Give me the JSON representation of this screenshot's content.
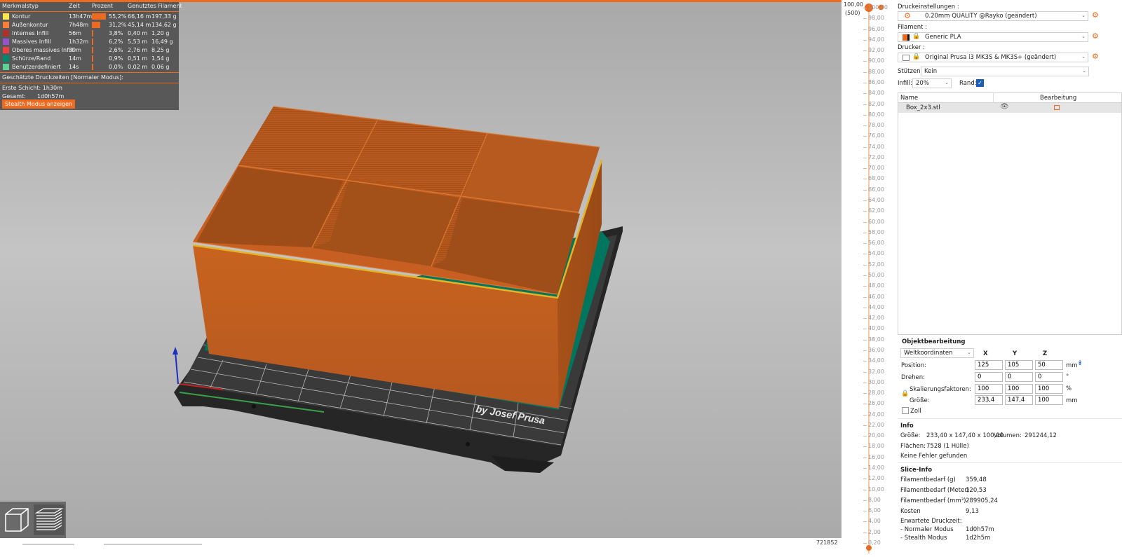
{
  "legend": {
    "headers": {
      "type": "Merkmalstyp",
      "time": "Zeit",
      "percent": "Prozent",
      "filament": "Genutztes Filament"
    },
    "rows": [
      {
        "name": "Kontur",
        "color": "#ffe64d",
        "time": "13h47m",
        "percent": "55,2%",
        "fraction": 0.552,
        "meters": "66,16 m",
        "grams": "197,33 g"
      },
      {
        "name": "Außenkontur",
        "color": "#ff7d38",
        "time": "7h48m",
        "percent": "31,2%",
        "fraction": 0.312,
        "meters": "45,14 m",
        "grams": "134,62 g"
      },
      {
        "name": "Internes Infill",
        "color": "#b03029",
        "time": "56m",
        "percent": "3,8%",
        "fraction": 0.038,
        "meters": "0,40 m",
        "grams": "1,20 g"
      },
      {
        "name": "Massives Infill",
        "color": "#9654cc",
        "time": "1h32m",
        "percent": "6,2%",
        "fraction": 0.062,
        "meters": "5,53 m",
        "grams": "16,49 g"
      },
      {
        "name": "Oberes massives Infill",
        "color": "#f04040",
        "time": "39m",
        "percent": "2,6%",
        "fraction": 0.026,
        "meters": "2,76 m",
        "grams": "8,25 g"
      },
      {
        "name": "Schürze/Rand",
        "color": "#00876e",
        "time": "14m",
        "percent": "0,9%",
        "fraction": 0.009,
        "meters": "0,51 m",
        "grams": "1,54 g"
      },
      {
        "name": "Benutzerdefiniert",
        "color": "#5ed194",
        "time": "14s",
        "percent": "0,0%",
        "fraction": 0.0,
        "meters": "0,02 m",
        "grams": "0,06 g"
      }
    ],
    "estimated_title": "Geschätzte Druckzeiten [Normaler Modus]:",
    "first_layer_label": "Erste Schicht:",
    "first_layer_value": "1h30m",
    "total_label": "Gesamt:",
    "total_value": "1d0h57m",
    "stealth_button": "Stealth Modus anzeigen"
  },
  "viewport": {
    "bed_logo": "by Josef Prusa",
    "bottom_id": "721852",
    "view_icons": [
      "cube-3d-icon",
      "layers-view-icon"
    ]
  },
  "slider": {
    "top_value": "100,00",
    "top_layer": "(500)",
    "bottom_value": "0,20",
    "ticks": [
      "100,00",
      "98,00",
      "96,00",
      "94,00",
      "92,00",
      "90,00",
      "88,00",
      "86,00",
      "84,00",
      "82,00",
      "80,00",
      "78,00",
      "76,00",
      "74,00",
      "72,00",
      "70,00",
      "68,00",
      "66,00",
      "64,00",
      "62,00",
      "60,00",
      "58,00",
      "56,00",
      "54,00",
      "52,00",
      "50,00",
      "48,00",
      "46,00",
      "44,00",
      "42,00",
      "40,00",
      "38,00",
      "36,00",
      "34,00",
      "32,00",
      "30,00",
      "28,00",
      "26,00",
      "24,00",
      "22,00",
      "20,00",
      "18,00",
      "16,00",
      "14,00",
      "12,00",
      "10,00",
      "8,00",
      "6,00",
      "4,00",
      "2,00",
      "0,20"
    ]
  },
  "panel": {
    "print_settings_label": "Druckeinstellungen :",
    "print_settings_value": "0.20mm QUALITY @Rayko (geändert)",
    "filament_label": "Filament :",
    "filament_value": "Generic PLA",
    "printer_label": "Drucker :",
    "printer_value": "Original Prusa i3 MK3S & MK3S+ (geändert)",
    "supports_label": "Stützen:",
    "supports_value": "Kein",
    "infill_label": "Infill:",
    "infill_value": "20%",
    "brim_label": "Rand:",
    "brim_checked": true,
    "list_col_name": "Name",
    "list_col_edit": "Bearbeitung",
    "object_name": "Box_2x3.stl",
    "obj_edit_title": "Objektbearbeitung",
    "coord_system": "Weltkoordinaten",
    "axis_x": "X",
    "axis_y": "Y",
    "axis_z": "Z",
    "position_label": "Position:",
    "position": [
      "125",
      "105",
      "50"
    ],
    "position_unit": "mm",
    "rotate_label": "Drehen:",
    "rotate": [
      "0",
      "0",
      "0"
    ],
    "rotate_unit": "°",
    "scale_label": "Skalierungsfaktoren:",
    "scale": [
      "100",
      "100",
      "100"
    ],
    "scale_unit": "%",
    "size_label": "Größe:",
    "size": [
      "233,4",
      "147,4",
      "100"
    ],
    "size_unit": "mm",
    "inch_label": "Zoll",
    "info_title": "Info",
    "info_size_label": "Größe:",
    "info_size_value": "233,40 x 147,40 x 100,00",
    "info_volume_label": "Volumen:",
    "info_volume_value": "291244,12",
    "info_faces_label": "Flächen:",
    "info_faces_value": "7528 (1 Hülle)",
    "info_errors": "Keine Fehler gefunden",
    "slice_title": "Slice-Info",
    "slice_rows": [
      {
        "label": "Filamentbedarf (g)",
        "value": "359,48"
      },
      {
        "label": "Filamentbedarf (Meter)",
        "value": "120,53"
      },
      {
        "label": "Filamentbedarf (mm³)",
        "value": "289905,24"
      },
      {
        "label": "Kosten",
        "value": "9,13"
      }
    ],
    "expected_time_label": "Erwartete Druckzeit:",
    "normal_mode_label": "- Normaler Modus",
    "normal_mode_value": "1d0h57m",
    "stealth_mode_label": "- Stealth Modus",
    "stealth_mode_value": "1d2h5m"
  },
  "colors": {
    "accent": "#ed6b21",
    "model": "#b85a1f",
    "bed": "#2a2a2a",
    "brim": "#00876e"
  }
}
